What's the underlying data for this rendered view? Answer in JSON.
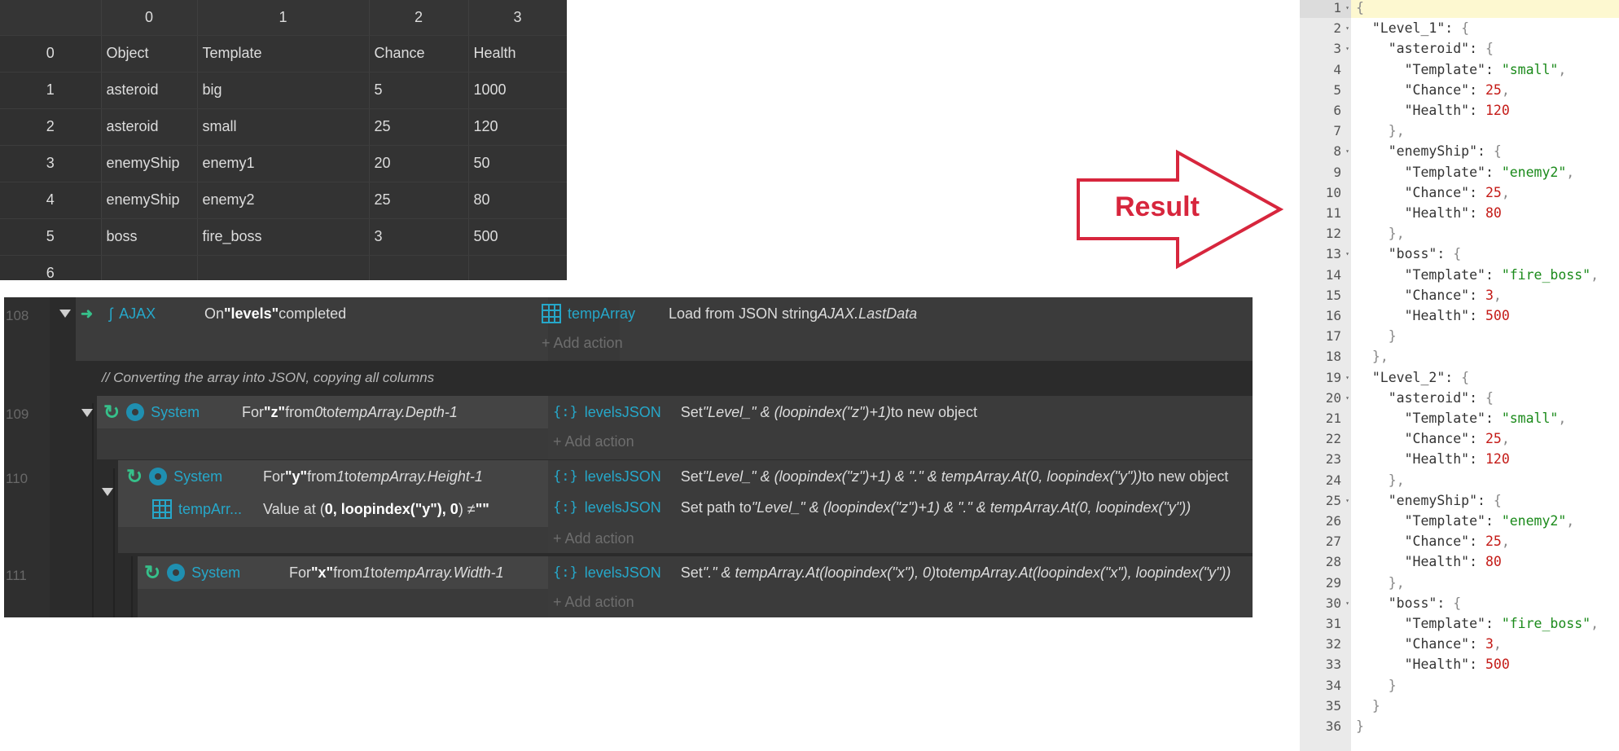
{
  "grid": {
    "col_headers": [
      "",
      "0",
      "1",
      "2",
      "3"
    ],
    "rows": [
      [
        "0",
        "Object",
        "Template",
        "Chance",
        "Health"
      ],
      [
        "1",
        "asteroid",
        "big",
        "5",
        "1000"
      ],
      [
        "2",
        "asteroid",
        "small",
        "25",
        "120"
      ],
      [
        "3",
        "enemyShip",
        "enemy1",
        "20",
        "50"
      ],
      [
        "4",
        "enemyShip",
        "enemy2",
        "25",
        "80"
      ],
      [
        "5",
        "boss",
        "fire_boss",
        "3",
        "500"
      ],
      [
        "6",
        "",
        "",
        "",
        ""
      ]
    ]
  },
  "sheet": {
    "comment": "//  Converting the array into JSON, copying all columns",
    "add_action": "+ Add action",
    "events": [
      {
        "line": "108",
        "object": "AJAX",
        "condition_pre": "On ",
        "condition_bold": "\"levels\"",
        "condition_post": " completed",
        "action_object": "tempArray",
        "action_pre": "Load from JSON string ",
        "action_italic": "AJAX.LastData"
      },
      {
        "line": "109",
        "object": "System",
        "condition_pre": "For ",
        "condition_bold": "\"z\"",
        "condition_mid": " from ",
        "condition_from": "0",
        "condition_to_word": " to ",
        "condition_to": "tempArray.Depth-1",
        "action_object": "levelsJSON",
        "action_pre": "Set ",
        "action_italic": "\"Level_\" & (loopindex(\"z\")+1)",
        "action_post": " to new object"
      },
      {
        "line": "110",
        "object": "System",
        "condition_pre": "For ",
        "condition_bold": "\"y\"",
        "condition_mid": " from ",
        "condition_from": "1",
        "condition_to_word": " to ",
        "condition_to": "tempArray.Height-1",
        "object2": "tempArr...",
        "condition2_pre": "Value at (",
        "condition2_bold": "0, loopindex(\"y\"), 0",
        "condition2_post": ") ≠ ",
        "condition2_val": "\"\"",
        "action_object": "levelsJSON",
        "action_pre": "Set ",
        "action_italic": "\"Level_\" & (loopindex(\"z\")+1) & \".\" & tempArray.At(0, loopindex(\"y\"))",
        "action_post": " to new object",
        "action2_object": "levelsJSON",
        "action2_pre": "Set path to ",
        "action2_italic": "\"Level_\" & (loopindex(\"z\")+1) & \".\" & tempArray.At(0, loopindex(\"y\"))"
      },
      {
        "line": "111",
        "object": "System",
        "condition_pre": "For ",
        "condition_bold": "\"x\"",
        "condition_mid": " from ",
        "condition_from": "1",
        "condition_to_word": " to ",
        "condition_to": "tempArray.Width-1",
        "action_object": "levelsJSON",
        "action_pre": "Set ",
        "action_italic": "\".\" & tempArray.At(loopindex(\"x\"), 0)",
        "action_post": " to ",
        "action_italic2": "tempArray.At(loopindex(\"x\"), loopindex(\"y\"))"
      }
    ]
  },
  "arrow_label": "Result",
  "editor": {
    "lines": [
      {
        "n": "1",
        "fold": true,
        "code": "{"
      },
      {
        "n": "2",
        "fold": true,
        "code": "  \"Level_1\": {"
      },
      {
        "n": "3",
        "fold": true,
        "code": "    \"asteroid\": {"
      },
      {
        "n": "4",
        "code": "      \"Template\": \"small\","
      },
      {
        "n": "5",
        "code": "      \"Chance\": 25,"
      },
      {
        "n": "6",
        "code": "      \"Health\": 120"
      },
      {
        "n": "7",
        "code": "    },"
      },
      {
        "n": "8",
        "fold": true,
        "code": "    \"enemyShip\": {"
      },
      {
        "n": "9",
        "code": "      \"Template\": \"enemy2\","
      },
      {
        "n": "10",
        "code": "      \"Chance\": 25,"
      },
      {
        "n": "11",
        "code": "      \"Health\": 80"
      },
      {
        "n": "12",
        "code": "    },"
      },
      {
        "n": "13",
        "fold": true,
        "code": "    \"boss\": {"
      },
      {
        "n": "14",
        "code": "      \"Template\": \"fire_boss\","
      },
      {
        "n": "15",
        "code": "      \"Chance\": 3,"
      },
      {
        "n": "16",
        "code": "      \"Health\": 500"
      },
      {
        "n": "17",
        "code": "    }"
      },
      {
        "n": "18",
        "code": "  },"
      },
      {
        "n": "19",
        "fold": true,
        "code": "  \"Level_2\": {"
      },
      {
        "n": "20",
        "fold": true,
        "code": "    \"asteroid\": {"
      },
      {
        "n": "21",
        "code": "      \"Template\": \"small\","
      },
      {
        "n": "22",
        "code": "      \"Chance\": 25,"
      },
      {
        "n": "23",
        "code": "      \"Health\": 120"
      },
      {
        "n": "24",
        "code": "    },"
      },
      {
        "n": "25",
        "fold": true,
        "code": "    \"enemyShip\": {"
      },
      {
        "n": "26",
        "code": "      \"Template\": \"enemy2\","
      },
      {
        "n": "27",
        "code": "      \"Chance\": 25,"
      },
      {
        "n": "28",
        "code": "      \"Health\": 80"
      },
      {
        "n": "29",
        "code": "    },"
      },
      {
        "n": "30",
        "fold": true,
        "code": "    \"boss\": {"
      },
      {
        "n": "31",
        "code": "      \"Template\": \"fire_boss\","
      },
      {
        "n": "32",
        "code": "      \"Chance\": 3,"
      },
      {
        "n": "33",
        "code": "      \"Health\": 500"
      },
      {
        "n": "34",
        "code": "    }"
      },
      {
        "n": "35",
        "code": "  }"
      },
      {
        "n": "36",
        "code": "}"
      }
    ]
  },
  "colors": {
    "teal": "#26a7c9",
    "loop_green": "#36c08a",
    "arrow_red": "#d7263d",
    "string_green": "#1a8a1a",
    "number_red": "#c41a16"
  }
}
